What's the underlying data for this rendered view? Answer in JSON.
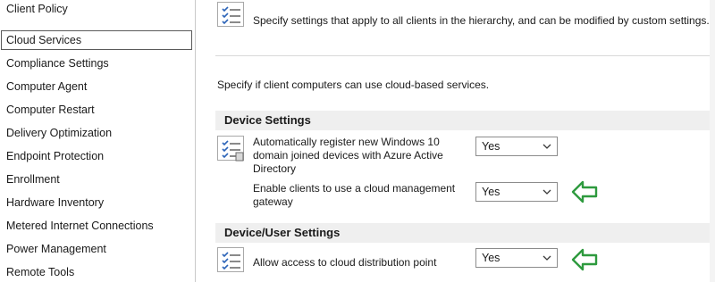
{
  "nav": {
    "items": [
      {
        "label": "Client Policy"
      },
      {
        "label": "Cloud Services",
        "selected": true
      },
      {
        "label": "Compliance Settings"
      },
      {
        "label": "Computer Agent"
      },
      {
        "label": "Computer Restart"
      },
      {
        "label": "Delivery Optimization"
      },
      {
        "label": "Endpoint Protection"
      },
      {
        "label": "Enrollment"
      },
      {
        "label": "Hardware Inventory"
      },
      {
        "label": "Metered Internet Connections"
      },
      {
        "label": "Power Management"
      },
      {
        "label": "Remote Tools"
      }
    ]
  },
  "panel": {
    "intro_text": "Specify settings that apply to all clients in the hierarchy, and can be modified by custom settings.",
    "description": "Specify if client computers can use cloud-based services.",
    "device_settings": {
      "header": "Device Settings",
      "auto_register": {
        "label_lines": [
          "Automatically register new Windows 10",
          "domain joined devices with Azure Active",
          "Directory"
        ],
        "value": "Yes"
      },
      "cmg": {
        "label_lines": [
          "Enable clients to use a cloud management",
          "gateway"
        ],
        "value": "Yes"
      }
    },
    "device_user_settings": {
      "header": "Device/User Settings",
      "cloud_dp": {
        "label": "Allow access to cloud distribution point",
        "value": "Yes"
      }
    }
  },
  "colors": {
    "accent_arrow": "#2e9a3e",
    "selected_border": "#5a5a5a",
    "section_header_bg": "#efefef"
  },
  "icons": [
    "policy-settings-icon",
    "chevron-down-icon",
    "green-arrow-icon"
  ]
}
